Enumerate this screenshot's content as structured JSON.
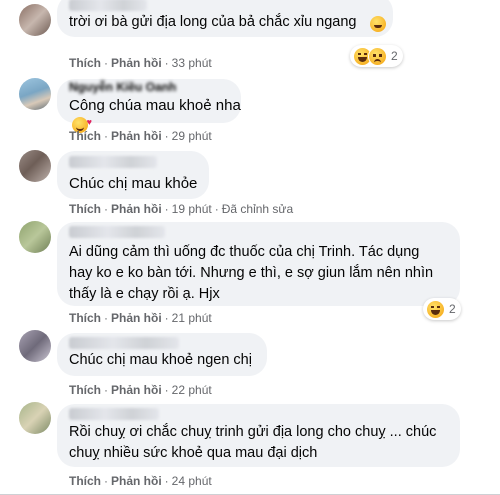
{
  "comments": [
    {
      "text": "trời ơi bà gửi địa long của bả chắc xỉu ngang",
      "actions": {
        "like": "Thích",
        "reply": "Phản hồi",
        "time": "33 phút"
      },
      "reactions": {
        "icons": [
          "laugh-icon",
          "sad-icon"
        ],
        "count": "2"
      }
    },
    {
      "name": "Nguyễn Kiều Oanh",
      "text": "Công chúa mau khoẻ nha",
      "actions": {
        "like": "Thích",
        "reply": "Phản hồi",
        "time": "29 phút"
      }
    },
    {
      "text": "Chúc chị mau khỏe",
      "actions": {
        "like": "Thích",
        "reply": "Phản hồi",
        "time": "19 phút",
        "edited": "Đã chỉnh sửa"
      }
    },
    {
      "text": "Ai dũng cảm thì uống đc thuốc của chị Trinh. Tác dụng\nhay ko e ko bàn tới. Nhưng e thì, e sợ giun lắm nên nhìn\nthấy là e chạy rồi ạ. Hjx",
      "actions": {
        "like": "Thích",
        "reply": "Phản hồi",
        "time": "21 phút"
      },
      "reactions": {
        "icons": [
          "laugh-icon"
        ],
        "count": "2"
      }
    },
    {
      "text": "Chúc chị mau khoẻ ngen chị",
      "actions": {
        "like": "Thích",
        "reply": "Phản hồi",
        "time": "22 phút"
      }
    },
    {
      "text": "Rồi chuỵ ơi chắc chuỵ trinh gửi địa long cho chuỵ ... chúc\nchuỵ nhiều sức khoẻ qua mau đại dịch",
      "actions": {
        "like": "Thích",
        "reply": "Phản hồi",
        "time": "24 phút"
      }
    }
  ],
  "colors": {
    "bubble": "#f0f2f5",
    "meta": "#65676b",
    "text": "#050505"
  }
}
